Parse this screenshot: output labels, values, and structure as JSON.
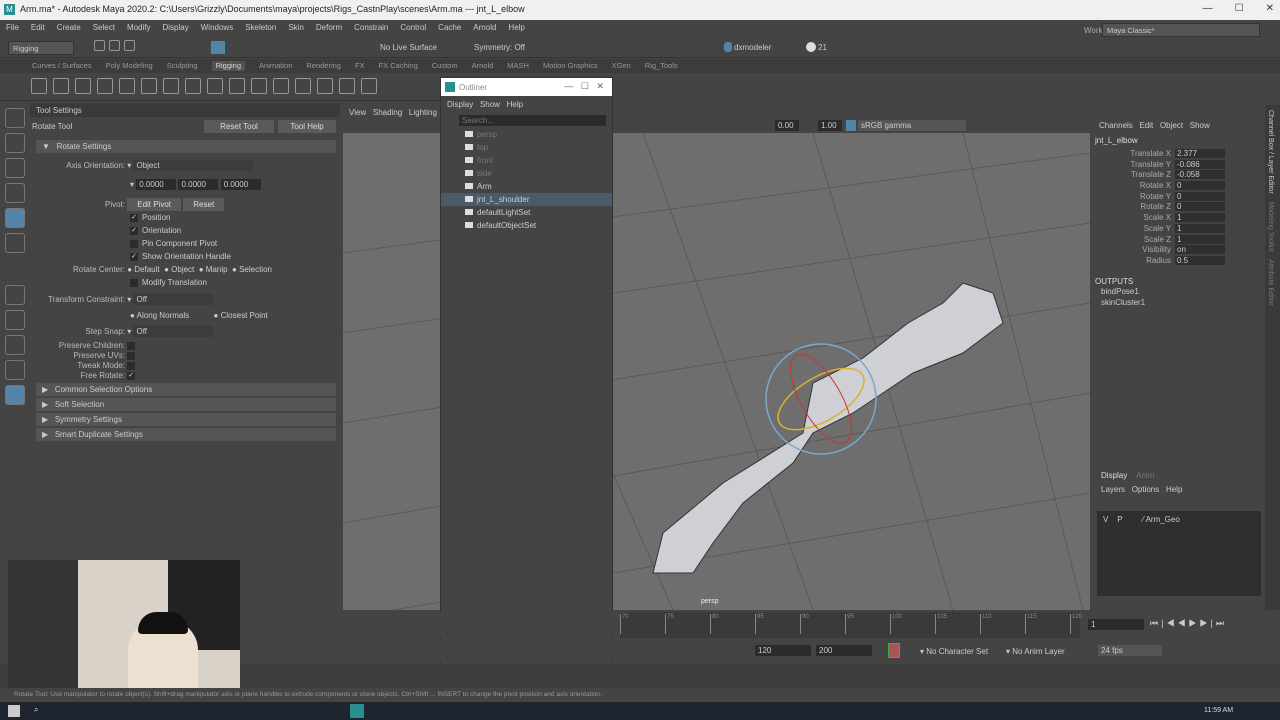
{
  "title": "Arm.ma* - Autodesk Maya 2020.2: C:\\Users\\Grizzly\\Documents\\maya\\projects\\Rigs_CastnPlay\\scenes\\Arm.ma  ---  jnt_L_elbow",
  "menus": [
    "File",
    "Edit",
    "Create",
    "Select",
    "Modify",
    "Display",
    "Windows",
    "Skeleton",
    "Skin",
    "Deform",
    "Constrain",
    "Control",
    "Cache",
    "Arnold",
    "Help"
  ],
  "status": {
    "menuset": "Rigging",
    "live_surface": "No Live Surface",
    "symmetry": "Symmetry: Off",
    "user": "dxmodeler",
    "count": "21",
    "workspace_label": "Workspace :",
    "workspace": "Maya Classic*"
  },
  "shelf_tabs": [
    "Curves / Surfaces",
    "Poly Modeling",
    "Sculpting",
    "Rigging",
    "Animation",
    "Rendering",
    "FX",
    "FX Caching",
    "Custom",
    "Arnold",
    "MASH",
    "Motion Graphics",
    "XGen",
    "Rig_Tools"
  ],
  "tool_settings": {
    "header": "Tool Settings",
    "tool": "Rotate Tool",
    "reset_tool": "Reset Tool",
    "tool_help": "Tool Help",
    "section": "Rotate Settings",
    "axis_orientation_label": "Axis Orientation:",
    "axis_orientation": "Object",
    "axis_values": [
      "0.0000",
      "0.0000",
      "0.0000"
    ],
    "pivot_label": "Pivot:",
    "edit_pivot": "Edit Pivot",
    "reset": "Reset",
    "position": "Position",
    "orientation": "Orientation",
    "pin_component_pivot": "Pin Component Pivot",
    "show_orientation_handle": "Show Orientation Handle",
    "rotate_center_label": "Rotate Center:",
    "rotate_center_options": [
      "Default",
      "Object",
      "Manip",
      "Selection"
    ],
    "modify_translation": "Modify Translation",
    "transform_constraint_label": "Transform Constraint:",
    "transform_constraint": "Off",
    "along_normals": "Along Normals",
    "closest_point": "Closest Point",
    "step_snap_label": "Step Snap:",
    "step_snap": "Off",
    "preserve_children": "Preserve Children:",
    "preserve_uvs": "Preserve UVs:",
    "tweak_mode": "Tweak Mode:",
    "free_rotate": "Free Rotate:",
    "collapsed_sections": [
      "Common Selection Options",
      "Soft Selection",
      "Symmetry Settings",
      "Smart Duplicate Settings"
    ]
  },
  "viewport": {
    "menus": [
      "View",
      "Shading",
      "Lighting"
    ],
    "exposure": "0.00",
    "gamma": "1.00",
    "color_space": "sRGB gamma",
    "camera": "persp"
  },
  "outliner": {
    "title": "Outliner",
    "menus": [
      "Display",
      "Show",
      "Help"
    ],
    "search_placeholder": "Search...",
    "items": [
      "persp",
      "top",
      "front",
      "side",
      "Arm",
      "jnt_L_shoulder",
      "defaultLightSet",
      "defaultObjectSet"
    ]
  },
  "channel_box": {
    "menus": [
      "Channels",
      "Edit",
      "Object",
      "Show"
    ],
    "node": "jnt_L_elbow",
    "channels": [
      {
        "name": "Translate X",
        "value": "2.377"
      },
      {
        "name": "Translate Y",
        "value": "-0.086"
      },
      {
        "name": "Translate Z",
        "value": "-0.058"
      },
      {
        "name": "Rotate X",
        "value": "0"
      },
      {
        "name": "Rotate Y",
        "value": "0"
      },
      {
        "name": "Rotate Z",
        "value": "0"
      },
      {
        "name": "Scale X",
        "value": "1"
      },
      {
        "name": "Scale Y",
        "value": "1"
      },
      {
        "name": "Scale Z",
        "value": "1"
      },
      {
        "name": "Visibility",
        "value": "on"
      },
      {
        "name": "Radius",
        "value": "0.5"
      }
    ],
    "outputs_label": "OUTPUTS",
    "outputs": [
      "bindPose1",
      "skinCluster1"
    ]
  },
  "side_tabs": [
    "Channel Box / Layer Editor",
    "Modeling Toolkit",
    "Attribute Editor"
  ],
  "layer_editor": {
    "tabs": [
      "Display",
      "Anim"
    ],
    "menus": [
      "Layers",
      "Options",
      "Help"
    ],
    "layer": {
      "v": "V",
      "p": "P",
      "name": "Arm_Geo"
    }
  },
  "timeline": {
    "ticks": [
      "70",
      "75",
      "80",
      "85",
      "90",
      "95",
      "100",
      "105",
      "110",
      "115",
      "120"
    ],
    "current_frame": "1",
    "range_end": "120",
    "anim_end": "200",
    "character_set": "No Character Set",
    "anim_layer": "No Anim Layer",
    "fps": "24 fps"
  },
  "help_line": "Rotate Tool: Use manipulator to rotate object(s). Shift+drag manipulator axis or plane handles to extrude components or clone objects. Ctrl+Shift ... INSERT to change the pivot position and axis orientation.",
  "taskbar": {
    "time": "11:59 AM"
  },
  "colors": {
    "accent": "#5285a6",
    "selection": "#4b5a6a"
  }
}
